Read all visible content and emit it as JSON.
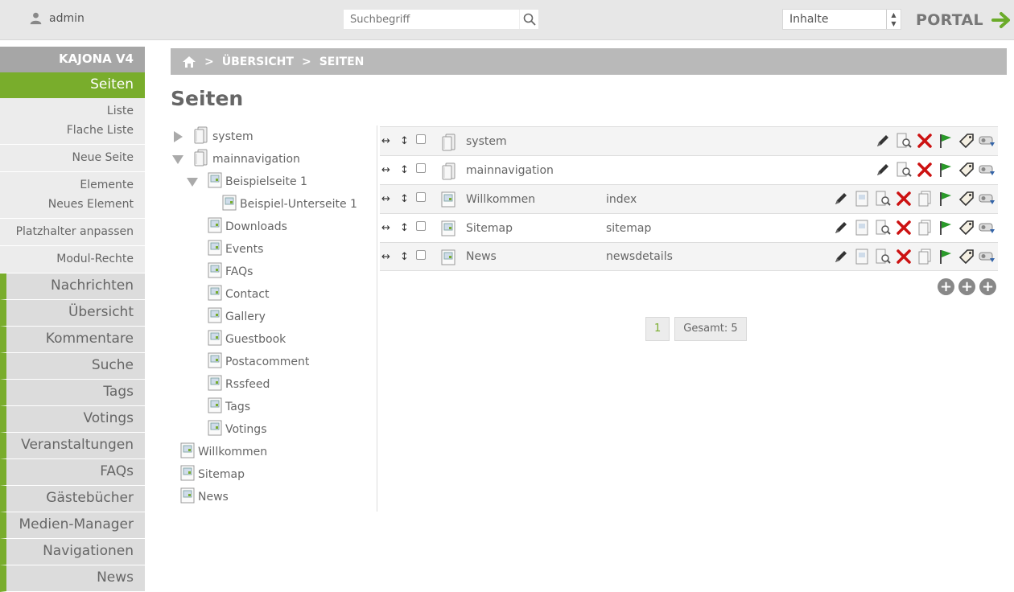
{
  "topbar": {
    "user": "admin",
    "search_placeholder": "Suchbegriff",
    "module_select": "Inhalte",
    "portal_label": "PORTAL"
  },
  "sidebar": {
    "brand": "KAJONA V4",
    "active_module": "Seiten",
    "sub_groups": [
      [
        "Liste",
        "Flache Liste"
      ],
      [
        "Neue Seite"
      ],
      [
        "Elemente",
        "Neues Element"
      ],
      [
        "Platzhalter anpassen"
      ],
      [
        "Modul-Rechte"
      ]
    ],
    "modules": [
      "Nachrichten",
      "Übersicht",
      "Kommentare",
      "Suche",
      "Tags",
      "Votings",
      "Veranstaltungen",
      "FAQs",
      "Gästebücher",
      "Medien-Manager",
      "Navigationen",
      "News"
    ]
  },
  "breadcrumb": [
    "ÜBERSICHT",
    "SEITEN"
  ],
  "page_title": "Seiten",
  "tree": [
    {
      "label": "system",
      "type": "folder",
      "toggle": "closed"
    },
    {
      "label": "mainnavigation",
      "type": "folder",
      "toggle": "open"
    },
    {
      "label": "Beispielseite 1",
      "type": "page",
      "toggle": "open"
    },
    {
      "label": "Beispiel-Unterseite 1",
      "type": "page",
      "toggle": "none"
    },
    {
      "label": "Downloads",
      "type": "page",
      "toggle": "none"
    },
    {
      "label": "Events",
      "type": "page",
      "toggle": "none"
    },
    {
      "label": "FAQs",
      "type": "page",
      "toggle": "none"
    },
    {
      "label": "Contact",
      "type": "page",
      "toggle": "none"
    },
    {
      "label": "Gallery",
      "type": "page",
      "toggle": "none"
    },
    {
      "label": "Guestbook",
      "type": "page",
      "toggle": "none"
    },
    {
      "label": "Postacomment",
      "type": "page",
      "toggle": "none"
    },
    {
      "label": "Rssfeed",
      "type": "page",
      "toggle": "none"
    },
    {
      "label": "Tags",
      "type": "page",
      "toggle": "none"
    },
    {
      "label": "Votings",
      "type": "page",
      "toggle": "none"
    },
    {
      "label": "Willkommen",
      "type": "page",
      "toggle": "none"
    },
    {
      "label": "Sitemap",
      "type": "page",
      "toggle": "none"
    },
    {
      "label": "News",
      "type": "page",
      "toggle": "none"
    }
  ],
  "list": {
    "rows": [
      {
        "title": "system",
        "name": "",
        "type": "folder"
      },
      {
        "title": "mainnavigation",
        "name": "",
        "type": "folder"
      },
      {
        "title": "Willkommen",
        "name": "index",
        "type": "page"
      },
      {
        "title": "Sitemap",
        "name": "sitemap",
        "type": "page"
      },
      {
        "title": "News",
        "name": "newsdetails",
        "type": "page"
      }
    ]
  },
  "pager": {
    "current": "1",
    "total": "Gesamt: 5"
  },
  "colors": {
    "accent": "#79ad2c",
    "breadcrumb_bg": "#b9b9b9",
    "sidebar_brand_bg": "#a6a6a6",
    "delete": "#cc1111"
  }
}
